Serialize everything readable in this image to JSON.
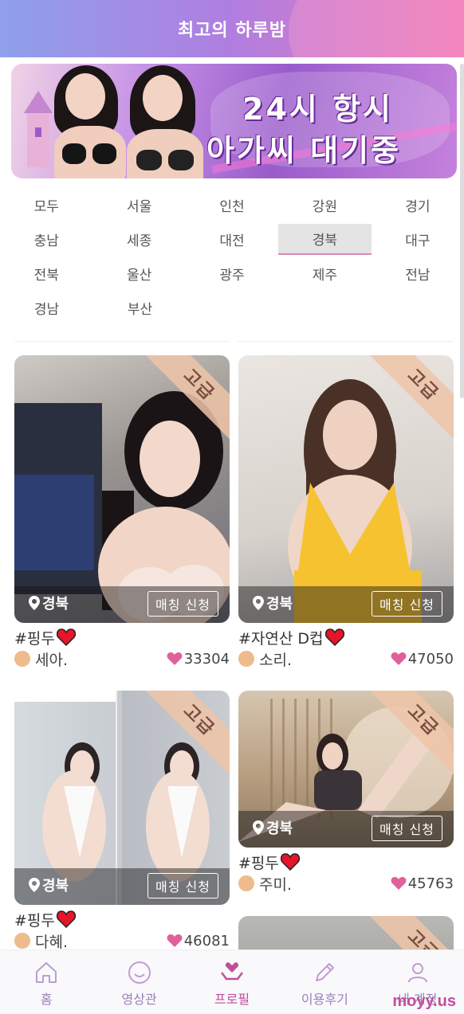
{
  "header": {
    "title": "최고의 하루밤"
  },
  "banner": {
    "line1": "24시 항시",
    "line2": "아가씨 대기중"
  },
  "regions": [
    [
      "모두",
      "서울",
      "인천",
      "강원",
      "경기"
    ],
    [
      "충남",
      "세종",
      "대전",
      "경북",
      "대구"
    ],
    [
      "전북",
      "울산",
      "광주",
      "제주",
      "전남"
    ],
    [
      "경남",
      "부산"
    ]
  ],
  "active_region": "경북",
  "cards": [
    {
      "badge": "고급",
      "location": "경북",
      "match": "매칭 신청",
      "tag": "#핑두",
      "name": "세아.",
      "likes": "33304"
    },
    {
      "badge": "고급",
      "location": "경북",
      "match": "매칭 신청",
      "tag": "#자연산 D컵",
      "name": "소리.",
      "likes": "47050"
    },
    {
      "badge": "고급",
      "location": "경북",
      "match": "매칭 신청",
      "tag": "#핑두",
      "name": "다혜.",
      "likes": "46081"
    },
    {
      "badge": "고급",
      "location": "경북",
      "match": "매칭 신청",
      "tag": "#핑두",
      "name": "주미.",
      "likes": "45763"
    },
    {
      "badge": "고급"
    }
  ],
  "nav": [
    {
      "label": "홈",
      "icon": "home-icon"
    },
    {
      "label": "영상관",
      "icon": "smile-icon"
    },
    {
      "label": "프로필",
      "icon": "heart-hands-icon",
      "active": true
    },
    {
      "label": "이용후기",
      "icon": "pencil-icon"
    },
    {
      "label": "내 계정",
      "icon": "user-icon"
    }
  ],
  "watermark": "moyy.us",
  "colors": {
    "accent": "#c04f9b",
    "badge": "#eec4a8",
    "heart_pink": "#e0609e",
    "heart_red": "#e8142a"
  }
}
